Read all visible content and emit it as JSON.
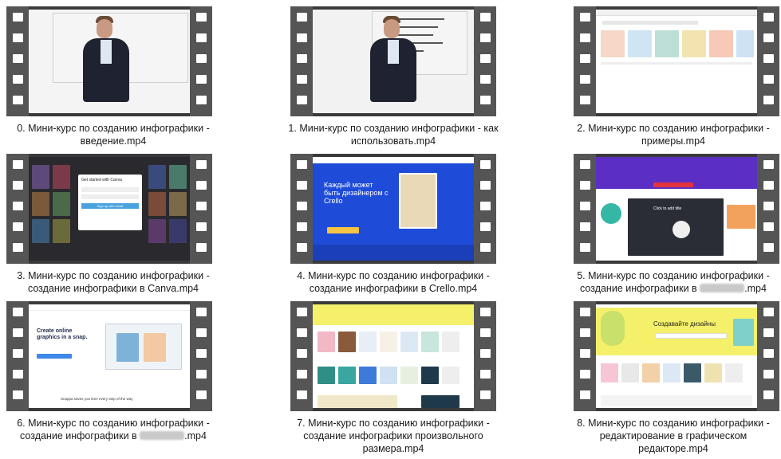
{
  "tiles": [
    {
      "caption_l1": "0. Мини-курс по созданию инфографики -",
      "caption_l2": "введение.mp4"
    },
    {
      "caption_l1": "1. Мини-курс по созданию инфографики - как",
      "caption_l2": "использовать.mp4"
    },
    {
      "caption_l1": "2. Мини-курс по созданию инфографики -",
      "caption_l2": "примеры.mp4"
    },
    {
      "caption_l1": "3. Мини-курс по созданию инфографики -",
      "caption_l2": "создание инфографики в Canva.mp4"
    },
    {
      "caption_l1": "4. Мини-курс по созданию инфографики -",
      "caption_l2": "создание инфографики в Crello.mp4"
    },
    {
      "caption_l1": "5. Мини-курс по созданию инфографики -",
      "caption_l2a": "создание инфографики в",
      "caption_l2b": ".mp4"
    },
    {
      "caption_l1": "6. Мини-курс по созданию инфографики -",
      "caption_l2a": "создание инфографики в",
      "caption_l2b": ".mp4"
    },
    {
      "caption_l1": "7. Мини-курс по созданию инфографики -",
      "caption_l2": "создание инфографики произвольного",
      "caption_l3": "размера.mp4"
    },
    {
      "caption_l1": "8. Мини-курс по созданию инфографики -",
      "caption_l2": "редактирование в графическом",
      "caption_l3": "редакторе.mp4"
    }
  ],
  "thumb_text": {
    "crello_headline_1": "Каждый может",
    "crello_headline_2": "быть дизайнером с",
    "crello_headline_3": "Crello",
    "snappa_headline_1": "Create online",
    "snappa_headline_2": "graphics in a snap.",
    "snappa_footer": "Snappa saves you time every step of the way",
    "canva_dialog_title": "Get started with Canva",
    "canva_dialog_btn": "Sign up with email",
    "editor_title": "Click to add title",
    "design_banner": "Создавайте дизайны"
  },
  "colors": {
    "film": "#3a3a3a",
    "crello_blue": "#1e4bd8",
    "crello_yellow": "#f6c343",
    "canva_purple": "#7b3fd6",
    "snappa_blue": "#3d89e8",
    "banner_yellow": "#f4f06a"
  }
}
